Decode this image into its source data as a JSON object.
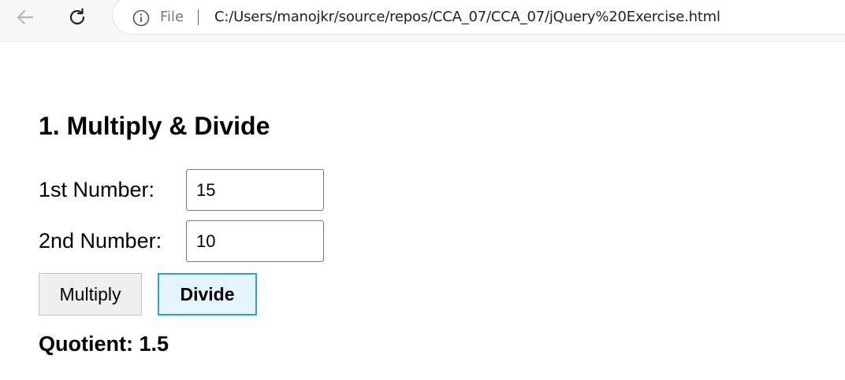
{
  "browser": {
    "address_scheme": "File",
    "url": "C:/Users/manojkr/source/repos/CCA_07/CCA_07/jQuery%20Exercise.html"
  },
  "page": {
    "title": "1. Multiply & Divide",
    "first_label": "1st Number:",
    "first_value": "15",
    "second_label": "2nd Number:",
    "second_value": "10",
    "multiply_label": "Multiply",
    "divide_label": "Divide",
    "result_text": "Quotient: 1.5"
  },
  "icons": {
    "back": "back-arrow-icon",
    "reload": "reload-icon",
    "info": "info-icon"
  },
  "colors": {
    "focus_border": "#2ba0d6",
    "focus_fill": "#e5f3fc"
  }
}
